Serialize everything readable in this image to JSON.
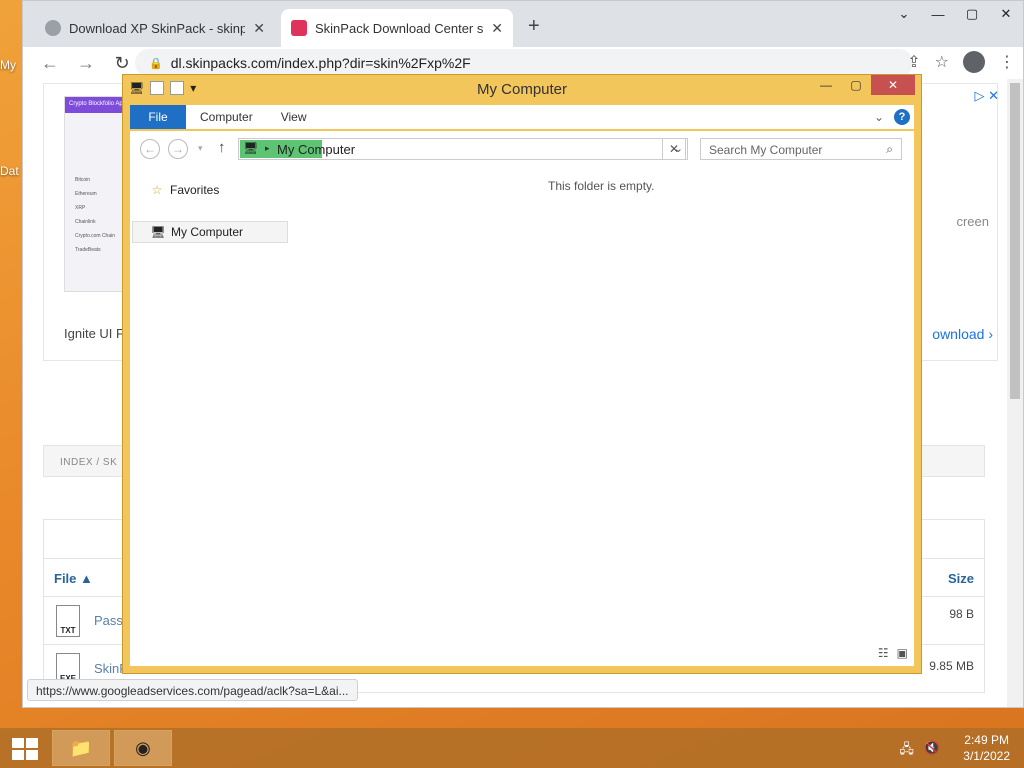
{
  "desktop": {
    "labels": [
      "My",
      "Dat"
    ]
  },
  "browser": {
    "tabs": [
      {
        "title": "Download XP SkinPack - skinpac",
        "active": false,
        "favicon_color": "#9aa0a6"
      },
      {
        "title": "SkinPack Download Center skin/",
        "active": true,
        "favicon_color": "#e0335b"
      }
    ],
    "url": "dl.skinpacks.com/index.php?dir=skin%2Fxp%2F",
    "status_url": "https://www.googleadservices.com/pagead/aclk?sa=L&ai...",
    "ad": {
      "thumb_header": "Crypto Blockfolio App",
      "thumb_rows": [
        "Bitcoin",
        "Ethereum",
        "XRP",
        "Chainlink",
        "Crypto.com Chain",
        "TradeBeats"
      ],
      "text": "Ignite UI For A",
      "right_text": "creen",
      "download": "ownload"
    },
    "breadcrumb": "INDEX  /   SK",
    "table": {
      "col_file": "File",
      "col_size": "Size",
      "rows": [
        {
          "name": "Passw",
          "type": "TXT",
          "size": "98 B"
        },
        {
          "name": "SkinP",
          "type": "EXE",
          "size": "9.85 MB"
        }
      ]
    }
  },
  "explorer": {
    "title": "My Computer",
    "ribbon_tabs": [
      "File",
      "Computer",
      "View"
    ],
    "address": "My Computer",
    "search_placeholder": "Search My Computer",
    "nav_favorites": "Favorites",
    "nav_computer": "My Computer",
    "empty_message": "This folder is empty."
  },
  "taskbar": {
    "time": "2:49 PM",
    "date": "3/1/2022"
  }
}
